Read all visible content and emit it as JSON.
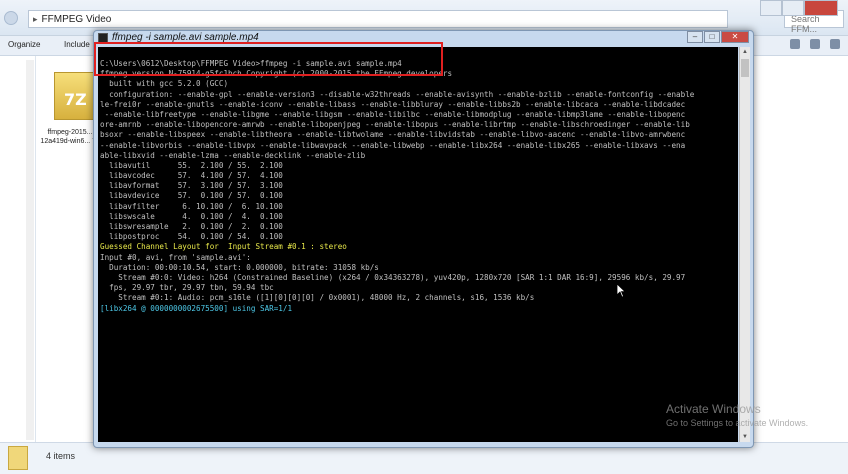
{
  "explorer": {
    "path": "FFMPEG Video",
    "search_placeholder": "Search FFM...",
    "toolbar": {
      "organize": "Organize",
      "include": "Include"
    },
    "file": {
      "ext_label": "7Z",
      "name": "ffmpeg-2015... 12a419d-win6... 7z"
    },
    "status": "4 items"
  },
  "console": {
    "title": "ffmpeg  -i sample.avi sample.mp4",
    "lines": [
      {
        "text": "C:\\Users\\0612\\Desktop\\FFMPEG Video>ffmpeg -i sample.avi sample.mp4",
        "style": "normal"
      },
      {
        "text": "ffmpeg version N-75914-g5fc1bch Copyright (c) 2000-2015 the FFmpeg developers",
        "style": "normal"
      },
      {
        "text": "  built with gcc 5.2.0 (GCC)",
        "style": "normal"
      },
      {
        "text": "  configuration: --enable-gpl --enable-version3 --disable-w32threads --enable-avisynth --enable-bzlib --enable-fontconfig --enable",
        "style": "normal"
      },
      {
        "text": "le-frei0r --enable-gnutls --enable-iconv --enable-libass --enable-libbluray --enable-libbs2b --enable-libcaca --enable-libdcadec",
        "style": "normal"
      },
      {
        "text": " --enable-libfreetype --enable-libgme --enable-libgsm --enable-libilbc --enable-libmodplug --enable-libmp3lame --enable-libopenc",
        "style": "normal"
      },
      {
        "text": "ore-amrnb --enable-libopencore-amrwb --enable-libopenjpeg --enable-libopus --enable-librtmp --enable-libschroedinger --enable-lib",
        "style": "normal"
      },
      {
        "text": "bsoxr --enable-libspeex --enable-libtheora --enable-libtwolame --enable-libvidstab --enable-libvo-aacenc --enable-libvo-amrwbenc",
        "style": "normal"
      },
      {
        "text": "--enable-libvorbis --enable-libvpx --enable-libwavpack --enable-libwebp --enable-libx264 --enable-libx265 --enable-libxavs --ena",
        "style": "normal"
      },
      {
        "text": "able-libxvid --enable-lzma --enable-decklink --enable-zlib",
        "style": "normal"
      },
      {
        "text": "  libavutil      55.  2.100 / 55.  2.100",
        "style": "normal"
      },
      {
        "text": "  libavcodec     57.  4.100 / 57.  4.100",
        "style": "normal"
      },
      {
        "text": "  libavformat    57.  3.100 / 57.  3.100",
        "style": "normal"
      },
      {
        "text": "  libavdevice    57.  0.100 / 57.  0.100",
        "style": "normal"
      },
      {
        "text": "  libavfilter     6. 10.100 /  6. 10.100",
        "style": "normal"
      },
      {
        "text": "  libswscale      4.  0.100 /  4.  0.100",
        "style": "normal"
      },
      {
        "text": "  libswresample   2.  0.100 /  2.  0.100",
        "style": "normal"
      },
      {
        "text": "  libpostproc    54.  0.100 / 54.  0.100",
        "style": "normal"
      },
      {
        "text": "Guessed Channel Layout for  Input Stream #0.1 : stereo",
        "style": "yellow"
      },
      {
        "text": "Input #0, avi, from 'sample.avi':",
        "style": "normal"
      },
      {
        "text": "  Duration: 00:00:10.54, start: 0.000000, bitrate: 31058 kb/s",
        "style": "normal"
      },
      {
        "text": "    Stream #0:0: Video: h264 (Constrained Baseline) (x264 / 0x34363278), yuv420p, 1280x720 [SAR 1:1 DAR 16:9], 29596 kb/s, 29.97",
        "style": "normal"
      },
      {
        "text": "  fps, 29.97 tbr, 29.97 tbn, 59.94 tbc",
        "style": "normal"
      },
      {
        "text": "    Stream #0:1: Audio: pcm_s16le ([1][0][0][0] / 0x0001), 48000 Hz, 2 channels, s16, 1536 kb/s",
        "style": "normal"
      },
      {
        "text": "[libx264 @ 0000000002675500] using SAR=1/1",
        "style": "cyan"
      }
    ]
  },
  "watermark": {
    "title": "Activate Windows",
    "subtitle": "Go to Settings to activate Windows."
  }
}
